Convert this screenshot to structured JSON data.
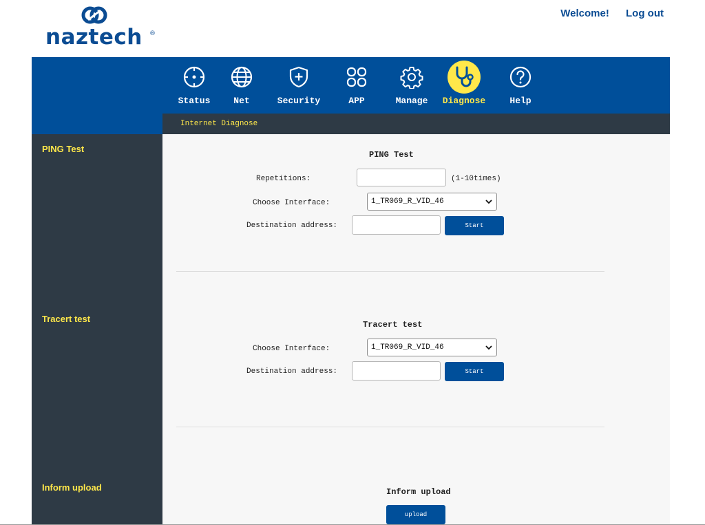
{
  "brand": {
    "name": "naztech",
    "reg": "®",
    "color": "#0b4c93"
  },
  "header": {
    "welcome": "Welcome!",
    "logout": "Log out"
  },
  "nav": {
    "items": [
      {
        "label": "Status",
        "icon": "crosshair-icon"
      },
      {
        "label": "Net",
        "icon": "globe-icon"
      },
      {
        "label": "Security",
        "icon": "shield-plus-icon"
      },
      {
        "label": "APP",
        "icon": "app-grid-icon"
      },
      {
        "label": "Manage",
        "icon": "gear-icon"
      },
      {
        "label": "Diagnose",
        "icon": "stethoscope-icon",
        "active": true
      },
      {
        "label": "Help",
        "icon": "help-icon"
      }
    ]
  },
  "subnav": {
    "label": "Internet Diagnose"
  },
  "sidebar": {
    "items": [
      "PING Test",
      "Tracert test",
      "Inform upload"
    ]
  },
  "ping": {
    "title": "PING Test",
    "repetitions_label": "Repetitions:",
    "repetitions_value": "",
    "repetitions_hint": "(1-10times)",
    "interface_label": "Choose Interface:",
    "interface_value": "1_TR069_R_VID_46",
    "dest_label": "Destination address:",
    "dest_value": "",
    "start": "Start"
  },
  "tracert": {
    "title": "Tracert test",
    "interface_label": "Choose Interface:",
    "interface_value": "1_TR069_R_VID_46",
    "dest_label": "Destination address:",
    "dest_value": "",
    "start": "Start"
  },
  "inform": {
    "title": "Inform upload",
    "upload": "upload"
  },
  "colors": {
    "nav_bg": "#004f9a",
    "sidebar_bg": "#2e3a45",
    "accent_yellow": "#ffe84a",
    "button": "#004f9a"
  }
}
